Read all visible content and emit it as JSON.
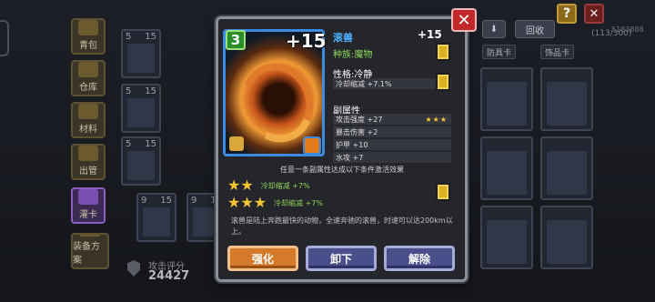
{
  "background": {
    "side_menu": [
      "青包",
      "仓库",
      "材料",
      "出管",
      "灌卡",
      "装备方案"
    ],
    "score_label": "攻击评分",
    "score_value": "24427",
    "top_buttons": [
      "回收"
    ],
    "tab_chips": [
      "防具卡",
      "饰品卡"
    ],
    "counter": "(113/300)",
    "user_id": "5183888",
    "cards": [
      {
        "num": "5",
        "lvl": "15"
      },
      {
        "num": "5",
        "lvl": "15"
      },
      {
        "num": "5",
        "lvl": "15"
      },
      {
        "num": "9",
        "lvl": "15"
      },
      {
        "num": "9",
        "lvl": "15"
      }
    ]
  },
  "modal": {
    "card": {
      "level": "3",
      "plus": "+15"
    },
    "name": "滚兽",
    "name_level": "+15",
    "race": "种族:魔物",
    "trait": {
      "title": "性格:冷静",
      "effect": "冷却缩减 +7.1%"
    },
    "sub_attr": {
      "title": "副属性",
      "rows": [
        {
          "text": "攻击强度 +27",
          "stars": "★★★"
        },
        {
          "text": "暴击伤害 +2",
          "stars": ""
        },
        {
          "text": "护甲 +10",
          "stars": ""
        },
        {
          "text": "水攻 +7",
          "stars": ""
        }
      ]
    },
    "set_note": "任意一条副属性达成以下条件激活效果",
    "set_bonuses": [
      {
        "stars": "★★",
        "text": "冷却缩减 +7%"
      },
      {
        "stars": "★★★",
        "text": "冷却缩减 +7%"
      }
    ],
    "description": "滚兽是陆上奔跑最快的动物，全速奔驰的滚兽，时速可以达200km以上。",
    "buttons": {
      "enhance": "强化",
      "unequip": "卸下",
      "dismantle": "解除"
    },
    "close": "✕"
  },
  "colors": {
    "accent_blue": "#3b8be0",
    "name_blue": "#4fb0ff",
    "green": "#8bd35a",
    "gold": "#f5c531",
    "close_red": "#c0282a",
    "enhance_orange": "#d47a2a",
    "purple_btn": "#4a4f8c"
  }
}
